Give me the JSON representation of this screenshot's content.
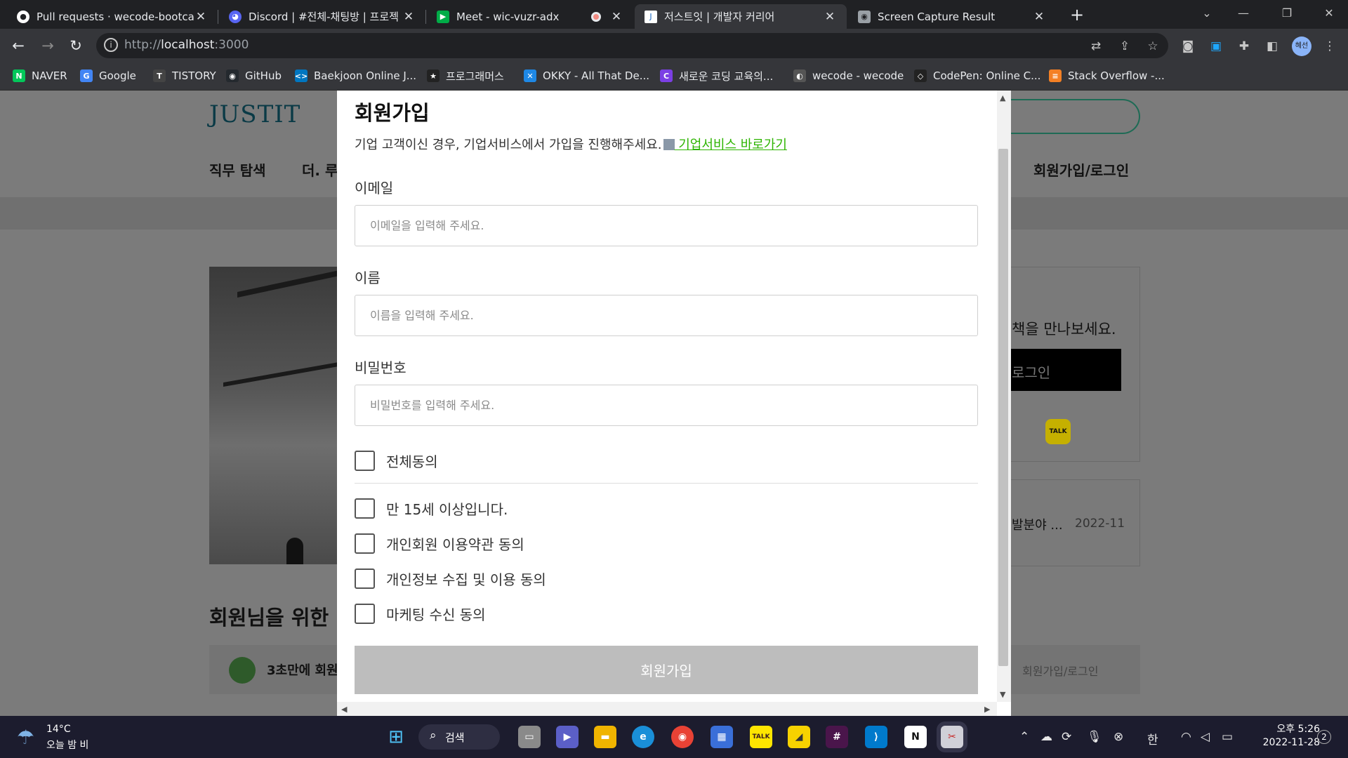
{
  "browser": {
    "tabs": [
      {
        "title": "Pull requests · wecode-bootcam",
        "icon": "github-icon"
      },
      {
        "title": "Discord | #전체-채팅방 | 프로젝",
        "icon": "discord-icon"
      },
      {
        "title": "Meet - wic-vuzr-adx",
        "icon": "meet-icon"
      },
      {
        "title": "저스트잇 | 개발자 커리어",
        "icon": "justit-icon"
      },
      {
        "title": "Screen Capture Result",
        "icon": "camera-icon"
      }
    ],
    "url_prefix": "http://",
    "url_host": "localhost",
    "url_rest": ":3000",
    "profile_initials": "혜선",
    "bookmarks": [
      {
        "label": "NAVER",
        "color": "#03c75a",
        "glyph": "N"
      },
      {
        "label": "Google",
        "color": "#4285f4",
        "glyph": "G"
      },
      {
        "label": "TISTORY",
        "color": "#444444",
        "glyph": "T"
      },
      {
        "label": "GitHub",
        "color": "#24292e",
        "glyph": "◉"
      },
      {
        "label": "Baekjoon Online J...",
        "color": "#0076c0",
        "glyph": "<>"
      },
      {
        "label": "프로그래머스",
        "color": "#222222",
        "glyph": "★"
      },
      {
        "label": "OKKY - All That De...",
        "color": "#1e88e5",
        "glyph": "✕"
      },
      {
        "label": "새로운 코딩 교육의...",
        "color": "#7b3fe4",
        "glyph": "C"
      },
      {
        "label": "wecode - wecode",
        "color": "#555555",
        "glyph": "◐"
      },
      {
        "label": "CodePen: Online C...",
        "color": "#222222",
        "glyph": "◇"
      },
      {
        "label": "Stack Overflow -...",
        "color": "#f48024",
        "glyph": "≡"
      }
    ]
  },
  "background_page": {
    "logo": "JUSTIT",
    "nav_1": "직무 탐색",
    "nav_2": "더. 루",
    "nav_login": "회원가입/로그인",
    "side_text": "책을 만나보세요.",
    "side_button": "로그인",
    "side_item": "발분야 ...",
    "side_date": "2022-11",
    "section_title": "회원님을 위한",
    "banner_text": "3초만에 회원",
    "banner_right": "회원가입/로그인"
  },
  "signup": {
    "title": "회원가입",
    "subtitle": "기업 고객이신 경우, 기업서비스에서 가입을 진행해주세요.",
    "link": " 기업서비스 바로가기",
    "email_label": "이메일",
    "email_placeholder": "이메일을 입력해 주세요.",
    "name_label": "이름",
    "name_placeholder": "이름을 입력해 주세요.",
    "password_label": "비밀번호",
    "password_placeholder": "비밀번호를 입력해 주세요.",
    "agree_all": "전체동의",
    "agree_items": [
      "만 15세 이상입니다.",
      "개인회원 이용약관 동의",
      "개인정보 수집 및 이용 동의",
      "마케팅 수신 동의"
    ],
    "submit": "회원가입"
  },
  "taskbar": {
    "weather_temp": "14°C",
    "weather_desc": "오늘 밤 비",
    "search": "검색",
    "ime": "한",
    "time": "오후 5:26",
    "date": "2022-11-28",
    "notifications": "2"
  }
}
